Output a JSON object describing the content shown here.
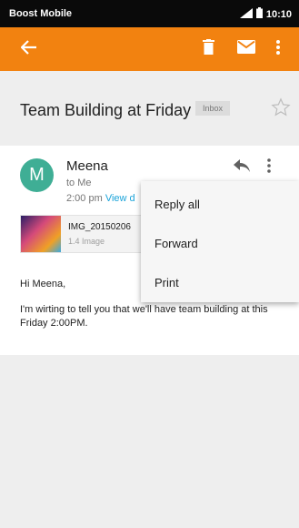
{
  "status_bar": {
    "carrier": "Boost Mobile",
    "time": "10:10",
    "signal_icon": "signal-icon",
    "battery_icon": "battery-icon"
  },
  "app_bar": {
    "color": "#f28210",
    "back_icon": "arrow-left-icon",
    "delete_icon": "trash-icon",
    "mail_icon": "mail-icon",
    "more_icon": "more-vert-icon"
  },
  "email": {
    "subject": "Team Building at Friday",
    "label": "Inbox",
    "sender": "Meena",
    "sender_initial": "M",
    "avatar_color": "#3fae95",
    "to": "to Me",
    "time": "2:00 pm",
    "view_link": "View d",
    "attachment": {
      "name": "IMG_20150206",
      "meta": "1.4 Image"
    },
    "greeting": "Hi Meena,",
    "body": "I'm wirting to tell you that we'll have team building at this Friday 2:00PM."
  },
  "menu": {
    "items": [
      "Reply all",
      "Forward",
      "Print"
    ]
  }
}
